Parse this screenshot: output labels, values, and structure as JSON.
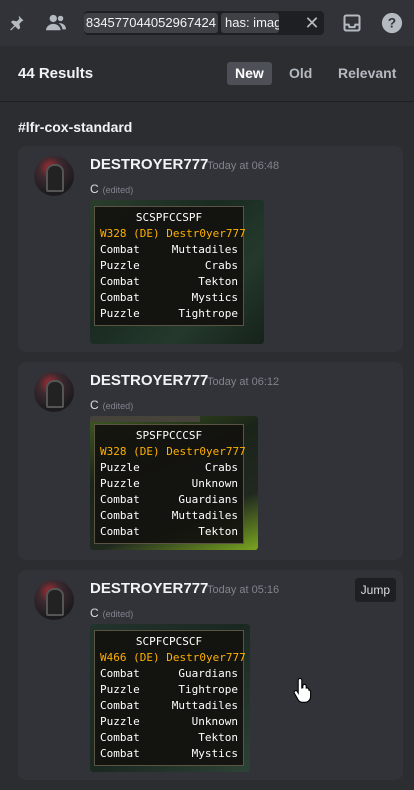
{
  "topbar": {
    "pin_icon": "pin-icon",
    "members_icon": "members-icon",
    "search_chip_id": "834577044052967424",
    "search_chip_has": "has: image",
    "clear_symbol": "✕",
    "inbox_icon": "inbox-icon",
    "help_icon": "help-icon"
  },
  "results": {
    "count": "44 Results",
    "sort_new": "New",
    "sort_old": "Old",
    "sort_relevant": "Relevant"
  },
  "channel_name": "#lfr-cox-standard",
  "messages": [
    {
      "author": "DESTROYER777",
      "timestamp": "Today at 06:48",
      "text": "C",
      "edited": "(edited)",
      "board": {
        "code": "SCSPFCCSPF",
        "party": "W328 (DE) Destr0yer777",
        "rows": [
          {
            "type": "Combat",
            "room": "Muttadiles"
          },
          {
            "type": "Puzzle",
            "room": "Crabs"
          },
          {
            "type": "Combat",
            "room": "Tekton"
          },
          {
            "type": "Combat",
            "room": "Mystics"
          },
          {
            "type": "Puzzle",
            "room": "Tightrope"
          }
        ]
      }
    },
    {
      "author": "DESTROYER777",
      "timestamp": "Today at 06:12",
      "text": "C",
      "edited": "(edited)",
      "board": {
        "code": "SPSFPCCCSF",
        "party": "W328 (DE) Destr0yer777",
        "rows": [
          {
            "type": "Puzzle",
            "room": "Crabs"
          },
          {
            "type": "Puzzle",
            "room": "Unknown"
          },
          {
            "type": "Combat",
            "room": "Guardians"
          },
          {
            "type": "Combat",
            "room": "Muttadiles"
          },
          {
            "type": "Combat",
            "room": "Tekton"
          }
        ]
      }
    },
    {
      "author": "DESTROYER777",
      "timestamp": "Today at 05:16",
      "text": "C",
      "edited": "(edited)",
      "jump_label": "Jump",
      "board": {
        "code": "SCPFCPCSCF",
        "party": "W466 (DE) Destr0yer777",
        "rows": [
          {
            "type": "Combat",
            "room": "Guardians"
          },
          {
            "type": "Puzzle",
            "room": "Tightrope"
          },
          {
            "type": "Combat",
            "room": "Muttadiles"
          },
          {
            "type": "Puzzle",
            "room": "Unknown"
          },
          {
            "type": "Combat",
            "room": "Tekton"
          },
          {
            "type": "Combat",
            "room": "Mystics"
          }
        ]
      }
    }
  ],
  "colors": {
    "background": "#2b2d31",
    "card": "#313338",
    "party_text": "#ffb000",
    "active_sort": "#4e5058"
  }
}
